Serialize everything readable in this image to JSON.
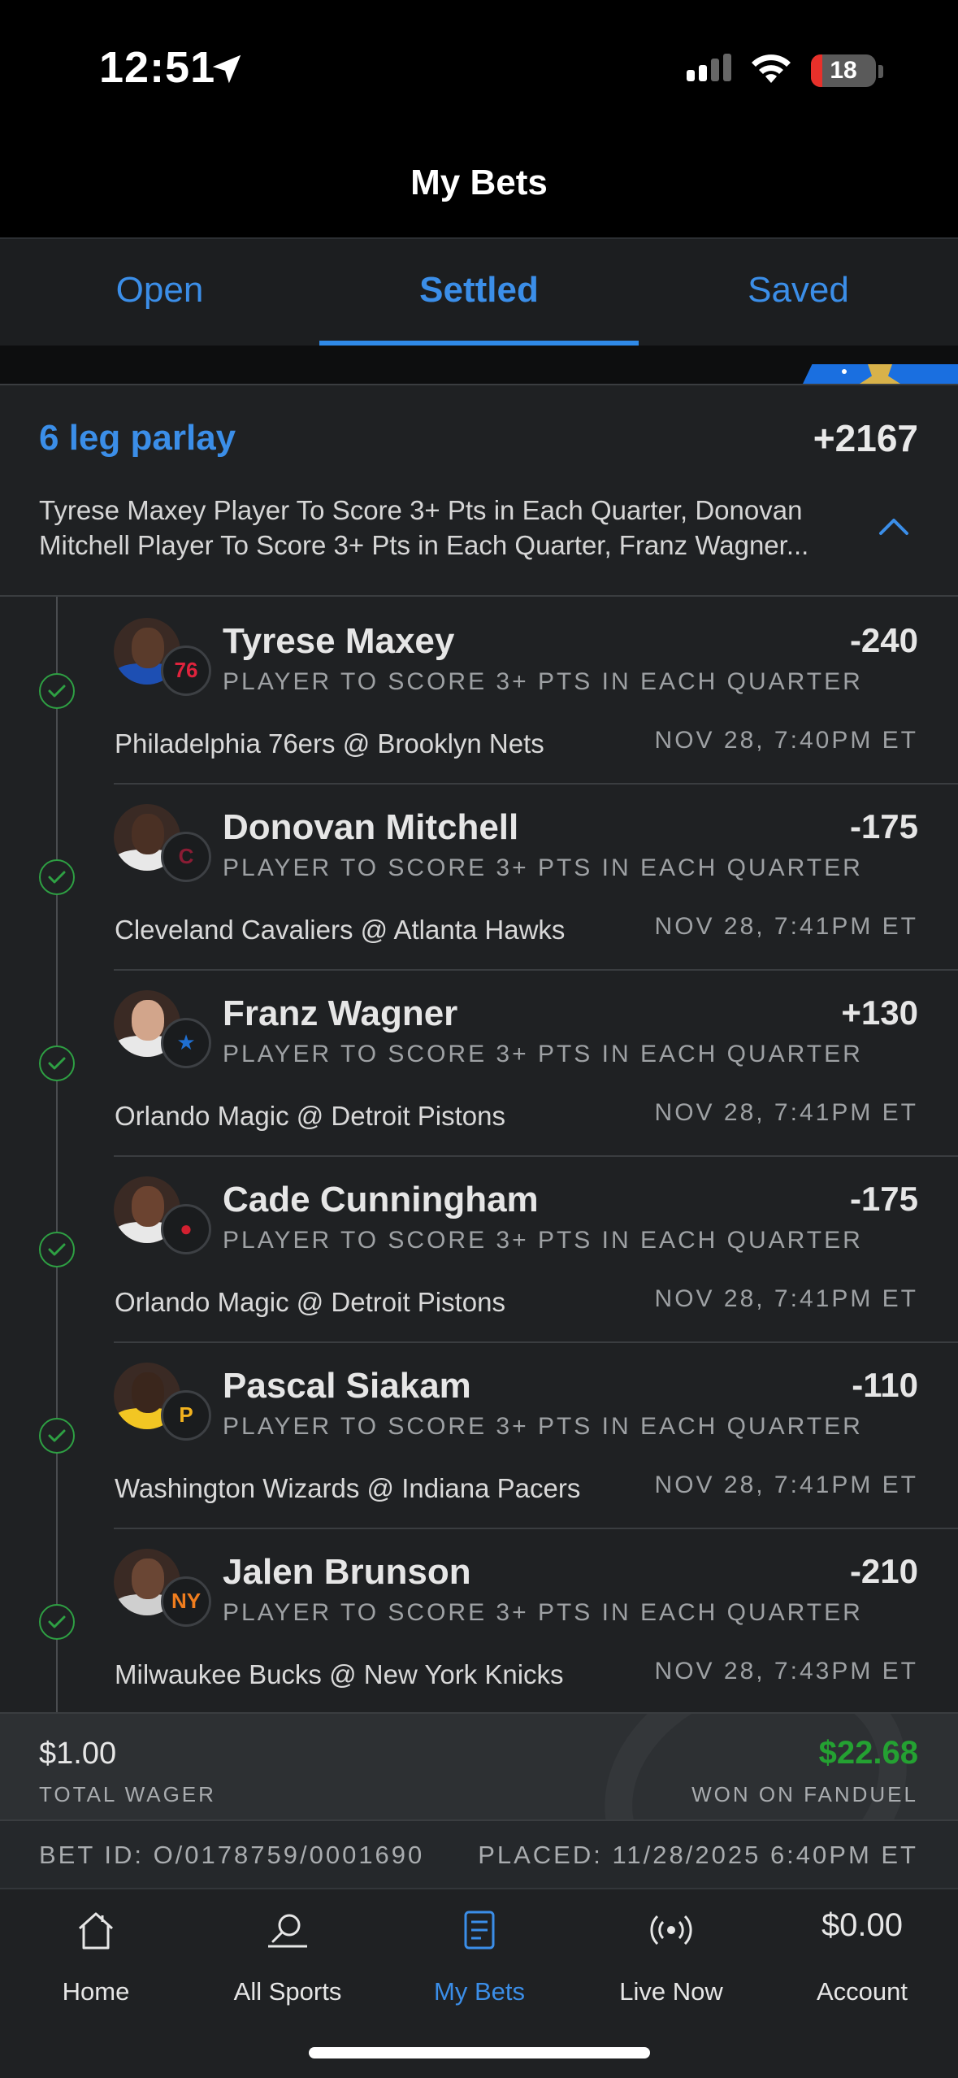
{
  "status_bar": {
    "time": "12:51",
    "battery": "18",
    "battery_level": 0.18
  },
  "header": {
    "title": "My Bets"
  },
  "tabs": [
    {
      "label": "Open",
      "active": false
    },
    {
      "label": "Settled",
      "active": true
    },
    {
      "label": "Saved",
      "active": false
    }
  ],
  "parlay": {
    "title": "6 leg parlay",
    "odds": "+2167",
    "summary": "Tyrese Maxey Player To Score 3+ Pts in Each Quarter, Donovan Mitchell Player To Score 3+ Pts in Each Quarter, Franz Wagner..."
  },
  "legs": [
    {
      "player": "Tyrese Maxey",
      "odds": "-240",
      "market": "PLAYER TO SCORE 3+ PTS IN EACH QUARTER",
      "matchup": "Philadelphia 76ers @ Brooklyn Nets",
      "when": "NOV 28, 7:40PM ET",
      "team_logo": "76",
      "team_color": "#e0233d",
      "jersey_color": "#1d4fb3",
      "skin": "#5a3b2b"
    },
    {
      "player": "Donovan Mitchell",
      "odds": "-175",
      "market": "PLAYER TO SCORE 3+ PTS IN EACH QUARTER",
      "matchup": "Cleveland Cavaliers @ Atlanta Hawks",
      "when": "NOV 28, 7:41PM ET",
      "team_logo": "C",
      "team_color": "#8a1c34",
      "jersey_color": "#e8e8e8",
      "skin": "#4a3024"
    },
    {
      "player": "Franz Wagner",
      "odds": "+130",
      "market": "PLAYER TO SCORE 3+ PTS IN EACH QUARTER",
      "matchup": "Orlando Magic @ Detroit Pistons",
      "when": "NOV 28, 7:41PM ET",
      "team_logo": "★",
      "team_color": "#1f6fd1",
      "jersey_color": "#e8e8e8",
      "skin": "#d2a58b"
    },
    {
      "player": "Cade Cunningham",
      "odds": "-175",
      "market": "PLAYER TO SCORE 3+ PTS IN EACH QUARTER",
      "matchup": "Orlando Magic @ Detroit Pistons",
      "when": "NOV 28, 7:41PM ET",
      "team_logo": "●",
      "team_color": "#d22030",
      "jersey_color": "#e8e8e8",
      "skin": "#6b4330"
    },
    {
      "player": "Pascal Siakam",
      "odds": "-110",
      "market": "PLAYER TO SCORE 3+ PTS IN EACH QUARTER",
      "matchup": "Washington Wizards @ Indiana Pacers",
      "when": "NOV 28, 7:41PM ET",
      "team_logo": "P",
      "team_color": "#f2b21e",
      "jersey_color": "#f2c623",
      "skin": "#3a261c"
    },
    {
      "player": "Jalen Brunson",
      "odds": "-210",
      "market": "PLAYER TO SCORE 3+ PTS IN EACH QUARTER",
      "matchup": "Milwaukee Bucks @ New York Knicks",
      "when": "NOV 28, 7:43PM ET",
      "team_logo": "NY",
      "team_color": "#f07d1e",
      "jersey_color": "#cfcfcf",
      "skin": "#6a4634"
    }
  ],
  "totals": {
    "wager": "$1.00",
    "wager_label": "TOTAL WAGER",
    "won": "$22.68",
    "won_label": "WON ON FANDUEL"
  },
  "meta": {
    "bet_id": "BET ID: O/0178759/0001690",
    "placed": "PLACED: 11/28/2025 6:40PM ET"
  },
  "bottom_nav": {
    "home": "Home",
    "all_sports": "All Sports",
    "my_bets": "My Bets",
    "live_now": "Live Now",
    "account_amount": "$0.00",
    "account": "Account"
  },
  "colors": {
    "accent": "#3b8ee8",
    "won": "#24a132",
    "check": "#2ea043"
  }
}
